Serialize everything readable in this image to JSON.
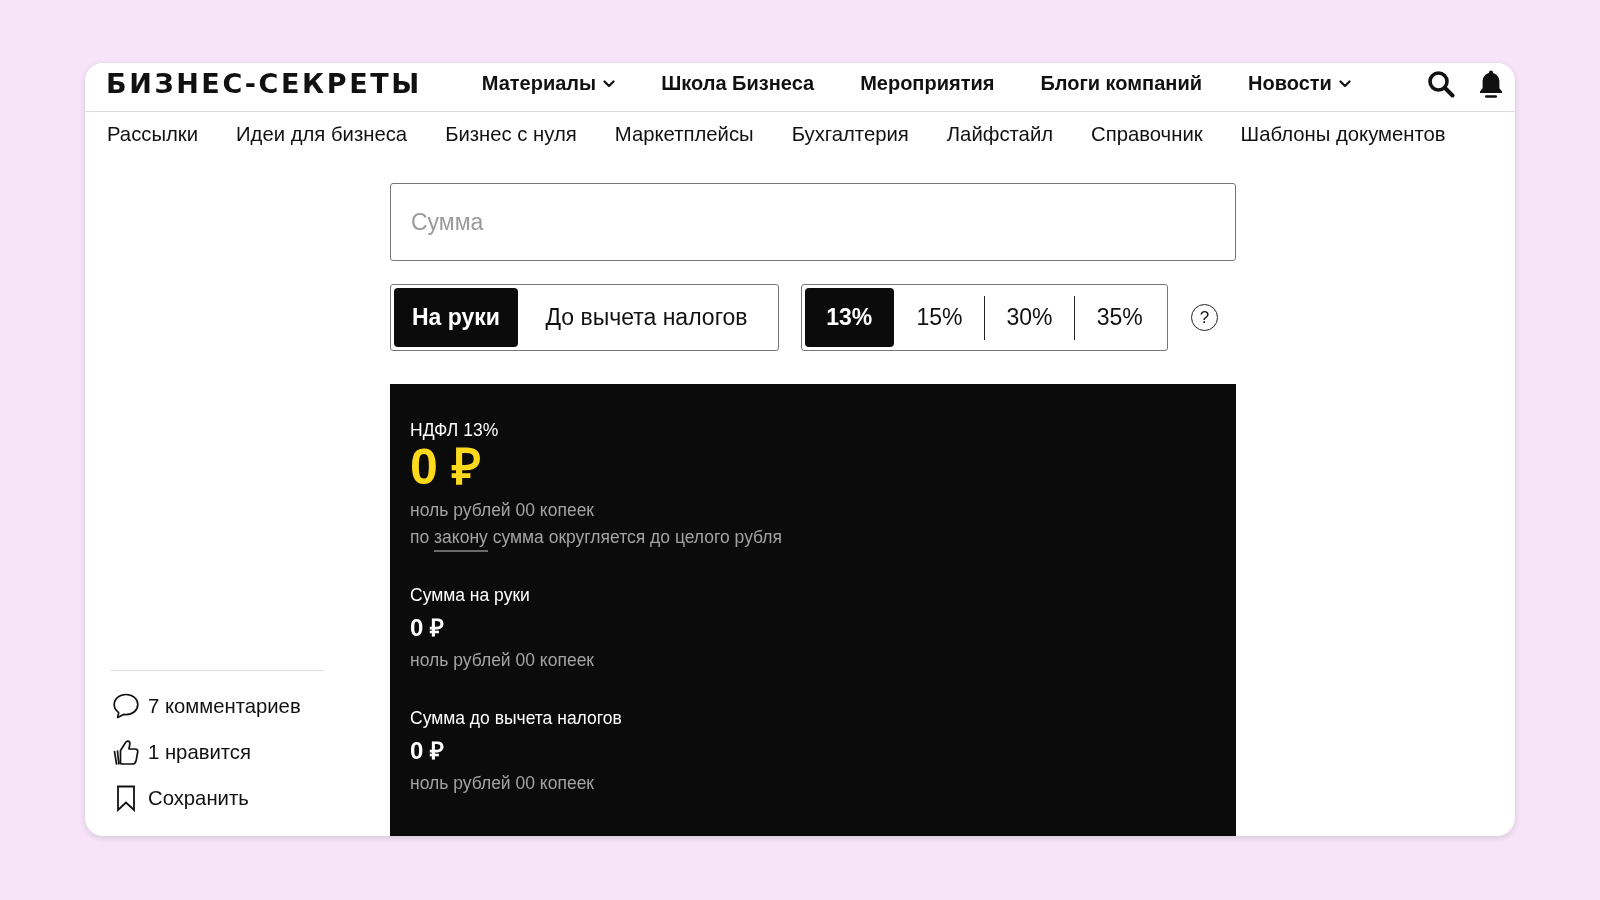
{
  "header": {
    "logo": "БИЗНЕС-СЕКРЕТЫ",
    "nav": [
      {
        "label": "Материалы",
        "has_dropdown": true
      },
      {
        "label": "Школа Бизнеса",
        "has_dropdown": false
      },
      {
        "label": "Мероприятия",
        "has_dropdown": false
      },
      {
        "label": "Блоги компаний",
        "has_dropdown": false
      },
      {
        "label": "Новости",
        "has_dropdown": true
      }
    ]
  },
  "subnav": [
    "Рассылки",
    "Идеи для бизнеса",
    "Бизнес с нуля",
    "Маркетплейсы",
    "Бухгалтерия",
    "Лайфстайл",
    "Справочник",
    "Шаблоны документов"
  ],
  "calculator": {
    "amount_field": {
      "placeholder": "Сумма"
    },
    "mode_options": [
      {
        "label": "На руки",
        "selected": true
      },
      {
        "label": "До вычета налогов",
        "selected": false
      }
    ],
    "rate_options": [
      {
        "label": "13%",
        "selected": true
      },
      {
        "label": "15%",
        "selected": false
      },
      {
        "label": "30%",
        "selected": false
      },
      {
        "label": "35%",
        "selected": false
      }
    ],
    "help": {
      "symbol": "?"
    },
    "result": {
      "tax": {
        "label": "НДФЛ 13%",
        "amount": "0 ₽",
        "in_words": "ноль рублей 00 копеек",
        "note": {
          "before": "по",
          "link": "закону",
          "after": "сумма округляется до целого рубля"
        }
      },
      "sums": [
        {
          "label": "Сумма на руки",
          "amount": "0 ₽",
          "in_words": "ноль рублей 00 копеек"
        },
        {
          "label": "Сумма до вычета налогов",
          "amount": "0 ₽",
          "in_words": "ноль рублей 00 копеек"
        }
      ]
    }
  },
  "sidebar": {
    "actions": [
      {
        "kind": "comment",
        "label": "7 комментариев"
      },
      {
        "kind": "like",
        "label": "1 нравится"
      },
      {
        "kind": "bookmark",
        "label": "Сохранить"
      }
    ]
  }
}
